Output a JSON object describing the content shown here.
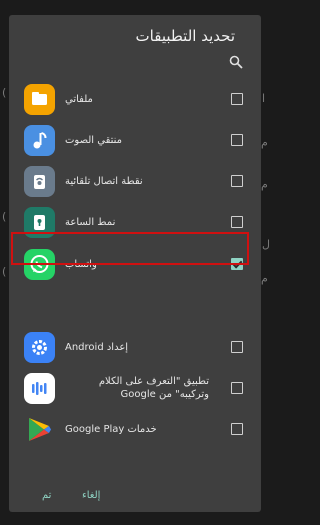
{
  "dialog": {
    "title": "تحديد التطبيقات",
    "apps": [
      {
        "name": "ملفاتي",
        "checked": false,
        "icon": "folder-icon",
        "color": "#f4a300"
      },
      {
        "name": "منتقي الصوت",
        "checked": false,
        "icon": "music-note-icon",
        "color": "#4a90e2"
      },
      {
        "name": "نقطة اتصال تلقائية",
        "checked": false,
        "icon": "hotspot-icon",
        "color": "#6a7b8c"
      },
      {
        "name": "نمط الساعة",
        "checked": false,
        "icon": "lock-icon",
        "color": "#1f7a67"
      },
      {
        "name": "واتساب",
        "checked": true,
        "icon": "whatsapp-icon",
        "color": "#25d366"
      },
      {
        "name": "إعداد Android",
        "checked": false,
        "icon": "gear-icon",
        "color": "#3b82f6"
      },
      {
        "name": "تطبيق \"التعرف على الكلام وتركيبه\" من Google",
        "checked": false,
        "icon": "speech-icon",
        "color": "#5b8def"
      },
      {
        "name": "خدمات Google Play",
        "checked": false,
        "icon": "google-play-icon",
        "color": "#34a853"
      }
    ],
    "cancel_label": "إلغاء",
    "done_label": "تم"
  }
}
